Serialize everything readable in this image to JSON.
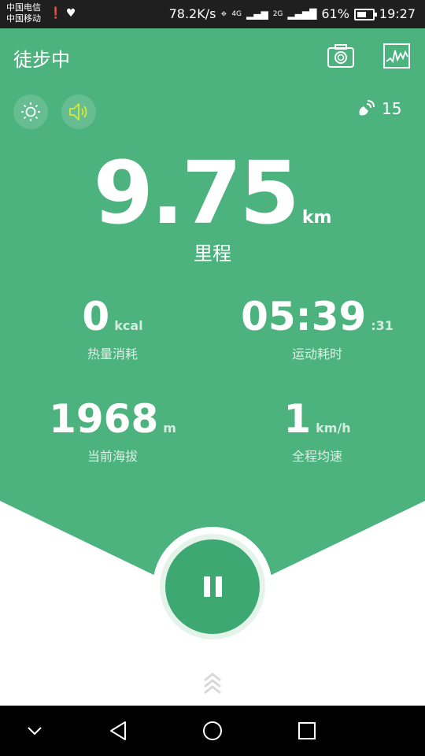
{
  "status_bar": {
    "carrier1": "中国电信",
    "carrier2": "中国移动",
    "net_speed": "78.2K/s",
    "net_type1": "4G",
    "net_type2": "2G",
    "battery": "61%",
    "time": "19:27"
  },
  "header": {
    "title": "徒步中",
    "camera_icon": "camera-icon",
    "chart_icon": "altitude-chart-icon"
  },
  "controls": {
    "light_icon": "sun-icon",
    "sound_icon": "speaker-icon",
    "gps_icon": "satellite-signal-icon",
    "gps_count": "15"
  },
  "distance": {
    "value": "9.75",
    "unit": "km",
    "label": "里程"
  },
  "stats": {
    "calories": {
      "value": "0",
      "unit": "kcal",
      "label": "热量消耗"
    },
    "duration": {
      "value": "05:39",
      "unit": ":31",
      "label": "运动耗时"
    },
    "altitude": {
      "value": "1968",
      "unit": "m",
      "label": "当前海拔"
    },
    "speed": {
      "value": "1",
      "unit": "km/h",
      "label": "全程均速"
    }
  },
  "actions": {
    "pause_icon": "pause-icon",
    "expand_icon": "double-chevron-up-icon"
  },
  "nav": {
    "hide_icon": "chevron-down-icon",
    "back_icon": "back-triangle-icon",
    "home_icon": "home-circle-icon",
    "recent_icon": "recent-square-icon"
  },
  "colors": {
    "primary_green": "#4cb37f",
    "button_green": "#3ea873",
    "sound_icon_yellow": "#d6e83a"
  }
}
